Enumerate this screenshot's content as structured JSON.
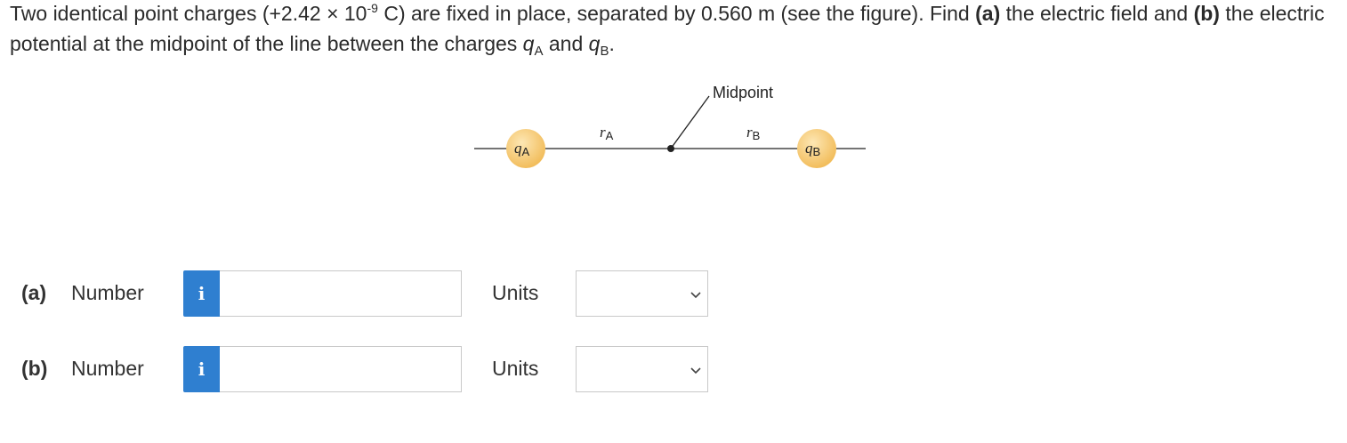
{
  "problem": {
    "prefix": "Two identical point charges (+2.42 × 10",
    "exponent": "-9",
    "mid1": " C) are fixed in place, separated by 0.560 m (see the figure). Find ",
    "part_a_tag": "(a)",
    "mid2": " the electric field and ",
    "part_b_tag": "(b)",
    "mid3": " the electric potential at the midpoint of the line between the charges ",
    "qa_sym": "q",
    "qa_sub": "A",
    "and_word": " and ",
    "qb_sym": "q",
    "qb_sub": "B",
    "end": "."
  },
  "figure": {
    "midpoint_label": "Midpoint",
    "ra_label": "r",
    "ra_sub": "A",
    "rb_label": "r",
    "rb_sub": "B",
    "qa_label": "q",
    "qa_sub": "A",
    "qb_label": "q",
    "qb_sub": "B",
    "charge_color": "#f4c46a",
    "charge_highlight": "#fde7b4"
  },
  "answers": {
    "a": {
      "part_label": "(a)",
      "number_label": "Number",
      "info_icon": "i",
      "number_value": "",
      "units_label": "Units",
      "units_selected": ""
    },
    "b": {
      "part_label": "(b)",
      "number_label": "Number",
      "info_icon": "i",
      "number_value": "",
      "units_label": "Units",
      "units_selected": ""
    }
  },
  "colors": {
    "info_button": "#2f7fd0"
  }
}
